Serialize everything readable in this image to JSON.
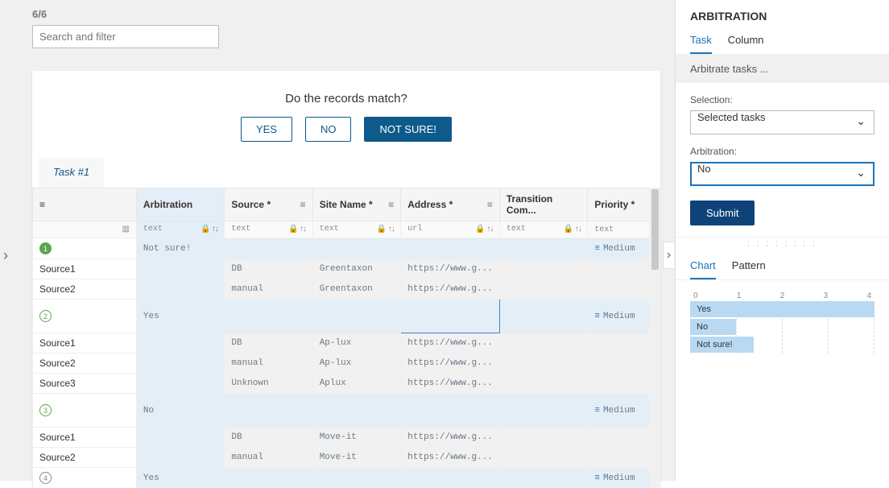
{
  "counter": "6/6",
  "search_placeholder": "Search and filter",
  "question": "Do the records match?",
  "buttons": {
    "yes": "YES",
    "no": "NO",
    "not_sure": "NOT SURE!"
  },
  "task_tab": "Task #1",
  "columns": {
    "col0": {
      "label": "",
      "type": ""
    },
    "col_arb": {
      "label": "Arbitration",
      "type": "text"
    },
    "col_src": {
      "label": "Source *",
      "type": "text"
    },
    "col_site": {
      "label": "Site Name *",
      "type": "text"
    },
    "col_addr": {
      "label": "Address *",
      "type": "url"
    },
    "col_tc": {
      "label": "Transition Com...",
      "type": "text"
    },
    "col_prio": {
      "label": "Priority *",
      "type": "text"
    }
  },
  "rows": {
    "g1": {
      "num": "1",
      "arb": "Not sure!",
      "prio": "Medium"
    },
    "g1a": {
      "label": "Source1",
      "src": "DB",
      "site": "Greentaxon",
      "addr": "https://www.g..."
    },
    "g1b": {
      "label": "Source2",
      "src": "manual",
      "site": "Greentaxon",
      "addr": "https://www.g..."
    },
    "g2": {
      "num": "2",
      "arb": "Yes",
      "prio": "Medium"
    },
    "g2a": {
      "label": "Source1",
      "src": "DB",
      "site": "Ap-lux",
      "addr": "https://www.g..."
    },
    "g2b": {
      "label": "Source2",
      "src": "manual",
      "site": "Ap-lux",
      "addr": "https://www.g..."
    },
    "g2c": {
      "label": "Source3",
      "src": "Unknown",
      "site": "Aplux",
      "addr": "https://www.g..."
    },
    "g3": {
      "num": "3",
      "arb": "No",
      "prio": "Medium"
    },
    "g3a": {
      "label": "Source1",
      "src": "DB",
      "site": "Move-it",
      "addr": "https://www.g..."
    },
    "g3b": {
      "label": "Source2",
      "src": "manual",
      "site": "Move-it",
      "addr": "https://www.g..."
    },
    "g4": {
      "num": "4",
      "arb": "Yes",
      "prio": "Medium"
    }
  },
  "right": {
    "title": "ARBITRATION",
    "tab_task": "Task",
    "tab_column": "Column",
    "bar": "Arbitrate tasks ...",
    "sel_label": "Selection:",
    "sel_value": "Selected tasks",
    "arb_label": "Arbitration:",
    "arb_value": "No",
    "submit": "Submit",
    "tab_chart": "Chart",
    "tab_pattern": "Pattern"
  },
  "chart_data": {
    "type": "bar",
    "categories": [
      "Yes",
      "No",
      "Not sure!"
    ],
    "values": [
      4,
      1,
      1
    ],
    "title": "",
    "xlabel": "",
    "ylabel": "",
    "xlim": [
      0,
      4
    ],
    "ticks": [
      "0",
      "1",
      "2",
      "3",
      "4"
    ]
  }
}
